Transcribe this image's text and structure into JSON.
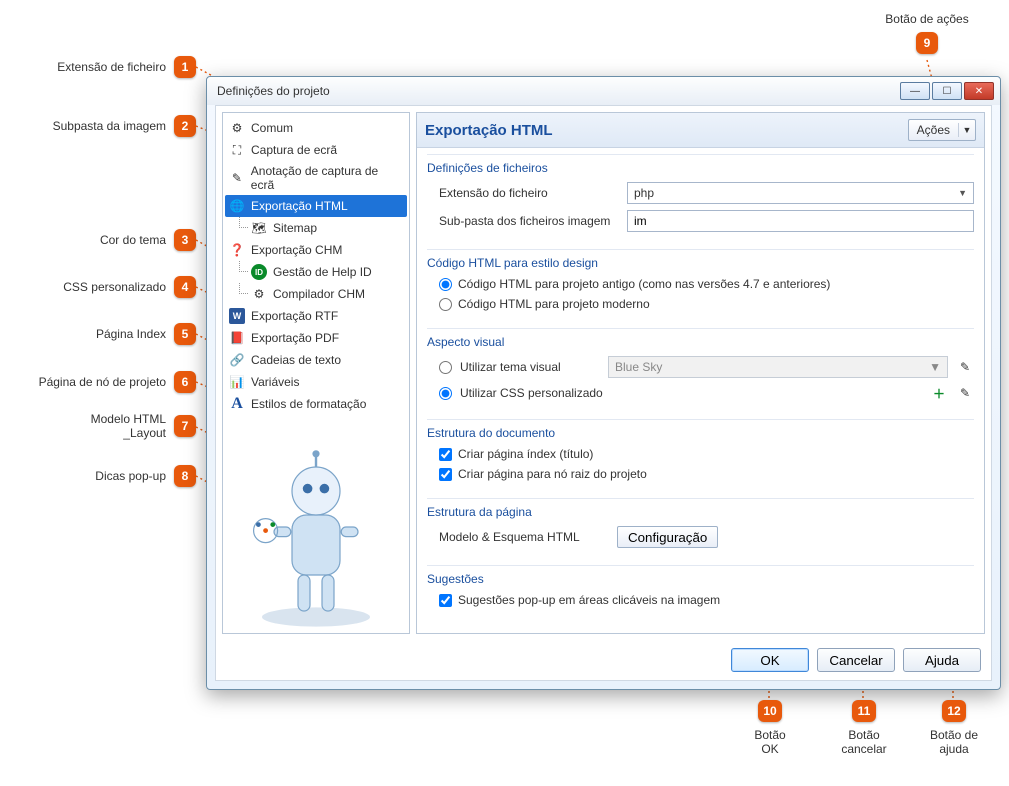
{
  "annotations": {
    "a1": {
      "num": "1",
      "label": "Extensão de ficheiro"
    },
    "a2": {
      "num": "2",
      "label": "Subpasta da imagem"
    },
    "a3": {
      "num": "3",
      "label": "Cor do tema"
    },
    "a4": {
      "num": "4",
      "label": "CSS personalizado"
    },
    "a5": {
      "num": "5",
      "label": "Página Index"
    },
    "a6": {
      "num": "6",
      "label": "Página de nó de projeto"
    },
    "a7": {
      "num": "7",
      "label": "Modelo HTML\n_Layout"
    },
    "a8": {
      "num": "8",
      "label": "Dicas pop-up"
    },
    "a9": {
      "num": "9",
      "label": "Botão de ações"
    },
    "a10": {
      "num": "10",
      "label": "Botão\nOK"
    },
    "a11": {
      "num": "11",
      "label": "Botão\ncancelar"
    },
    "a12": {
      "num": "12",
      "label": "Botão de\najuda"
    }
  },
  "window": {
    "title": "Definições do projeto"
  },
  "sidebar": {
    "items": [
      {
        "icon": "⚙",
        "label": "Comum"
      },
      {
        "icon": "⛶",
        "label": "Captura de ecrã"
      },
      {
        "icon": "✎",
        "label": "Anotação de captura de ecrã"
      },
      {
        "icon": "🌐",
        "label": "Exportação HTML"
      },
      {
        "icon": "🗺",
        "label": "Sitemap"
      },
      {
        "icon": "❓",
        "label": "Exportação CHM"
      },
      {
        "icon": "ID",
        "label": "Gestão de Help ID"
      },
      {
        "icon": "⚙",
        "label": "Compilador CHM"
      },
      {
        "icon": "W",
        "label": "Exportação RTF"
      },
      {
        "icon": "📕",
        "label": "Exportação PDF"
      },
      {
        "icon": "🔗",
        "label": "Cadeias de texto"
      },
      {
        "icon": "📊",
        "label": "Variáveis"
      },
      {
        "icon": "A",
        "label": "Estilos de formatação"
      }
    ]
  },
  "main": {
    "heading": "Exportação HTML",
    "actions_label": "Ações",
    "sec_files": {
      "title": "Definições de ficheiros",
      "ext_label": "Extensão do ficheiro",
      "ext_value": "php",
      "sub_label": "Sub-pasta dos ficheiros imagem",
      "sub_value": "im"
    },
    "sec_code": {
      "title": "Código HTML para estilo design",
      "opt_old": "Código HTML para projeto antigo (como nas versões 4.7 e anteriores)",
      "opt_new": "Código HTML para projeto moderno"
    },
    "sec_visual": {
      "title": "Aspecto visual",
      "opt_theme": "Utilizar tema visual",
      "theme_value": "Blue Sky",
      "opt_css": "Utilizar CSS personalizado"
    },
    "sec_doc": {
      "title": "Estrutura do documento",
      "chk_index": "Criar página índex (título)",
      "chk_root": "Criar página para nó raiz do projeto"
    },
    "sec_page": {
      "title": "Estrutura da página",
      "model_label": "Modelo & Esquema HTML",
      "config_btn": "Configuração"
    },
    "sec_sugg": {
      "title": "Sugestões",
      "chk_popup": "Sugestões pop-up em áreas clicáveis na imagem"
    }
  },
  "footer": {
    "ok": "OK",
    "cancel": "Cancelar",
    "help": "Ajuda"
  }
}
